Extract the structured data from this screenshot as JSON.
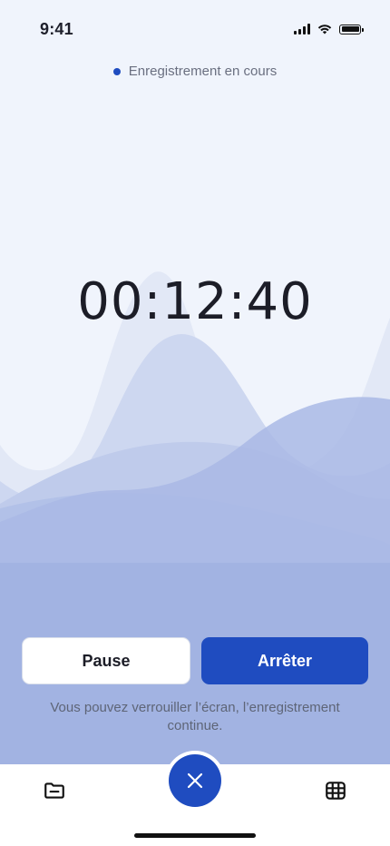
{
  "status_bar": {
    "time": "9:41",
    "icons": [
      "signal-icon",
      "wifi-icon",
      "battery-icon"
    ]
  },
  "recording": {
    "status_label": "Enregistrement en cours",
    "timer": "00:12:40"
  },
  "actions": {
    "pause_label": "Pause",
    "stop_label": "Arrêter"
  },
  "hint": "Vous pouvez verrouiller l’écran, l’enregistrement continue.",
  "tab_bar": {
    "left_icon": "folder-icon",
    "center_icon": "close-icon",
    "right_icon": "grid-icon"
  },
  "colors": {
    "accent": "#1f4cc0",
    "background": "#f0f4fc",
    "wave_base": "#a2b3e2"
  }
}
